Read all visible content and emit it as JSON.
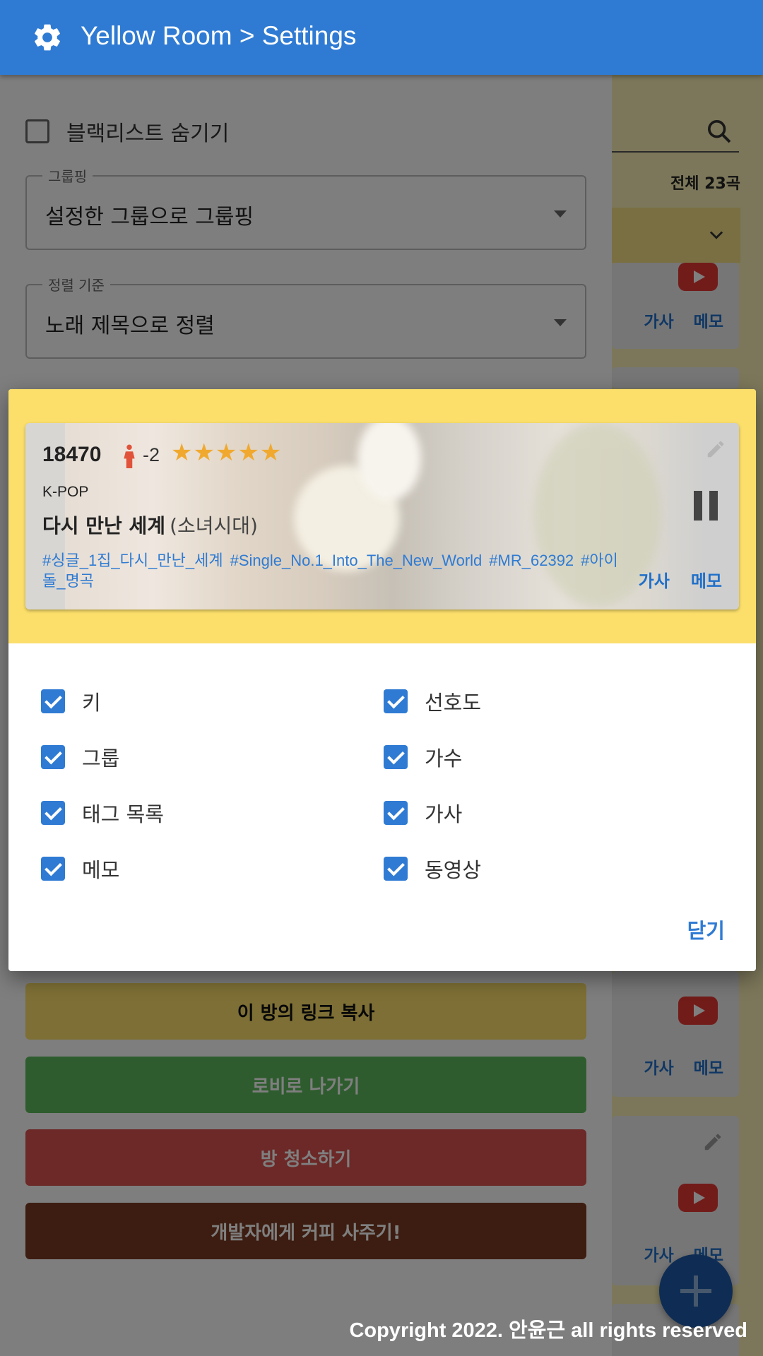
{
  "app_bar": {
    "title": "Yellow Room > Settings"
  },
  "background_list": {
    "total_count": "전체 23곡",
    "card_actions": {
      "lyrics": "가사",
      "memo": "메모"
    }
  },
  "settings": {
    "hide_blacklist": {
      "label": "블랙리스트 숨기기",
      "checked": false
    },
    "grouping": {
      "legend": "그룹핑",
      "value": "설정한 그룹으로 그룹핑"
    },
    "sorting": {
      "legend": "정렬 기준",
      "value": "노래 제목으로 정렬"
    },
    "buttons": {
      "copy_link": "이 방의 링크 복사",
      "to_lobby": "로비로 나가기",
      "clean_room": "방 청소하기",
      "buy_coffee": "개발자에게 커피 사주기!"
    },
    "copyright": "Copyright 2022. 안윤근 all rights reserved"
  },
  "dialog": {
    "preview": {
      "number": "18470",
      "key": "-2",
      "stars": "★★★★★",
      "rating": 5,
      "group": "K-POP",
      "title": "다시 만난 세계",
      "artist": "(소녀시대)",
      "tags": [
        "#싱글_1집_다시_만난_세계",
        "#Single_No.1_Into_The_New_World",
        "#MR_62392",
        "#아이돌_명곡"
      ],
      "lyrics_label": "가사",
      "memo_label": "메모"
    },
    "options": [
      {
        "label": "키",
        "checked": true
      },
      {
        "label": "선호도",
        "checked": true
      },
      {
        "label": "그룹",
        "checked": true
      },
      {
        "label": "가수",
        "checked": true
      },
      {
        "label": "태그 목록",
        "checked": true
      },
      {
        "label": "가사",
        "checked": true
      },
      {
        "label": "메모",
        "checked": true
      },
      {
        "label": "동영상",
        "checked": true
      }
    ],
    "close_label": "닫기"
  },
  "colors": {
    "primary": "#2f7bd3",
    "yellow": "#fbdf6a",
    "green": "#5cb85c",
    "red": "#d9534f",
    "brown": "#7b3b23",
    "star": "#f0a92e"
  }
}
